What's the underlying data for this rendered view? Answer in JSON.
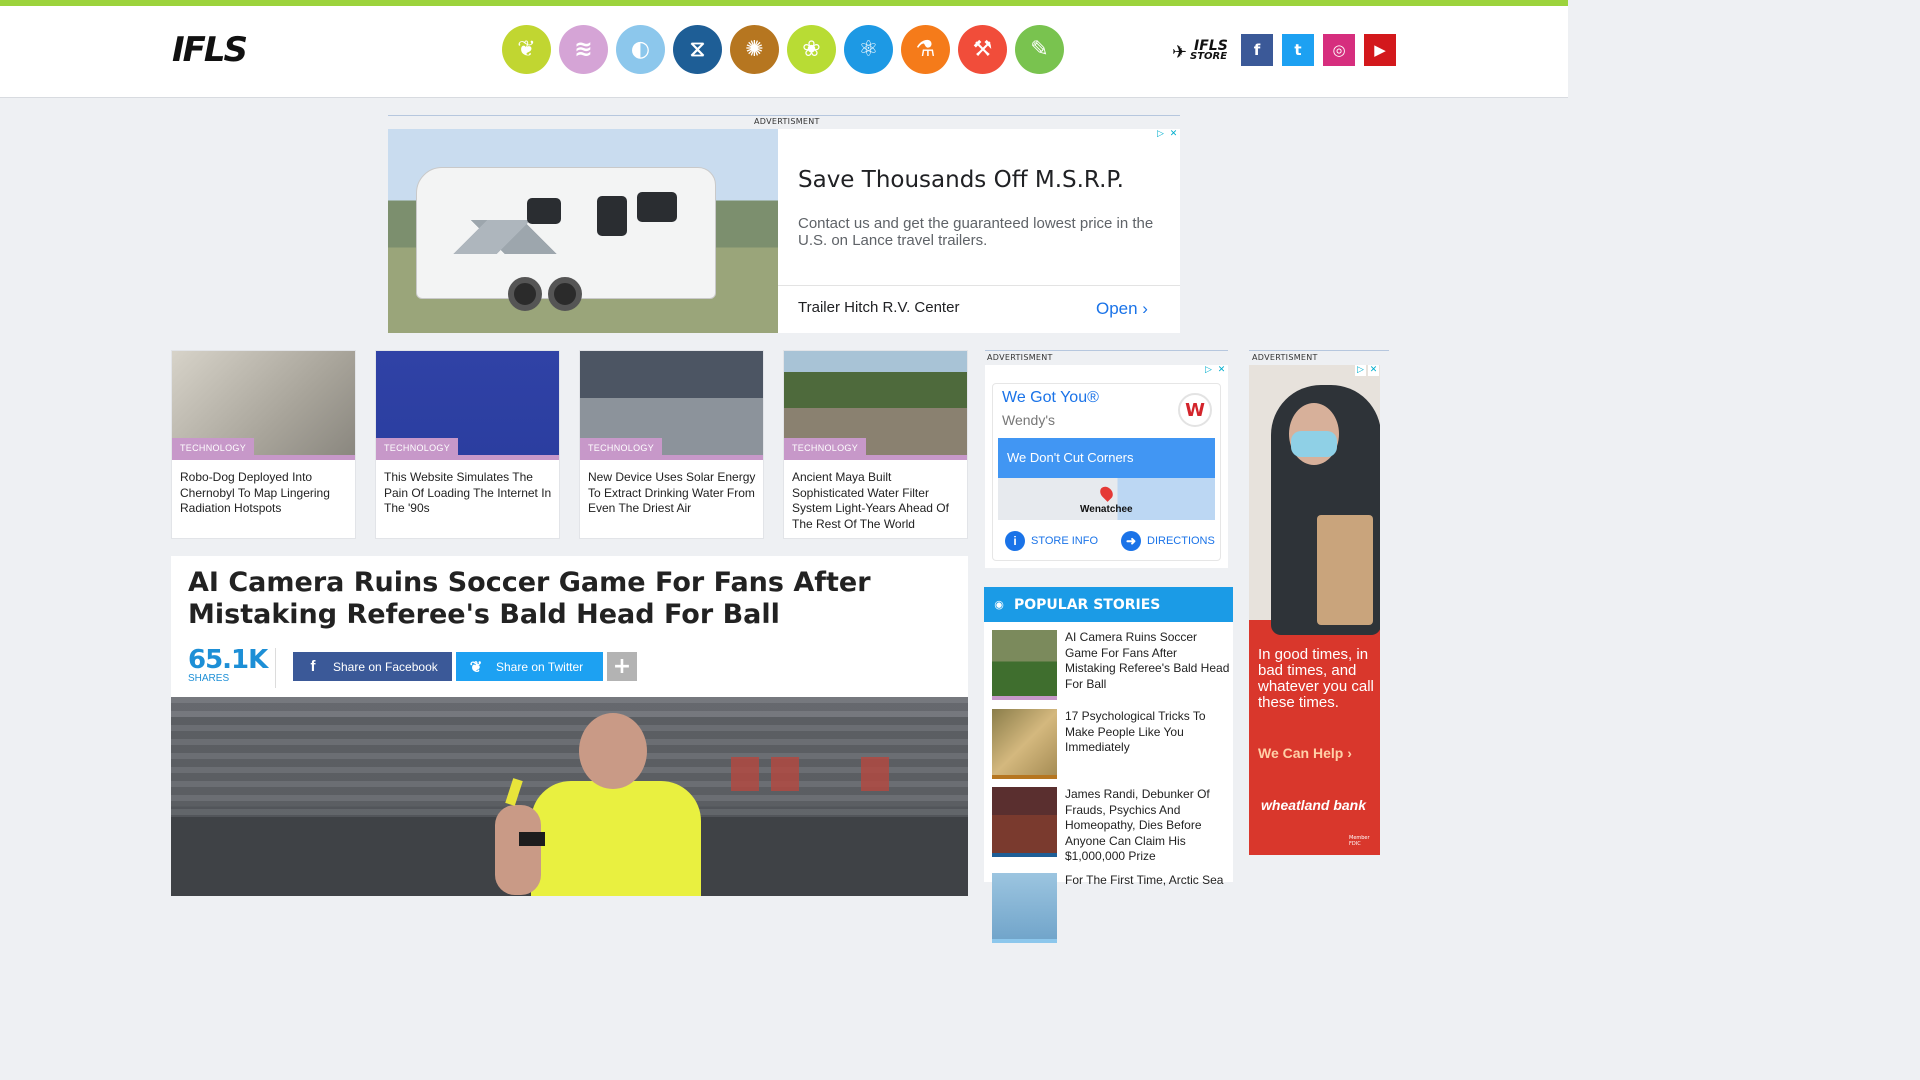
{
  "brand": {
    "logo_text": "IFLS",
    "store_text_1": "IFLS",
    "store_text_2": "STORE"
  },
  "categories": [
    {
      "name": "environment",
      "icon": "leaf-icon",
      "color": "#c1d631",
      "glyph": "❦"
    },
    {
      "name": "technology",
      "icon": "wifi-icon",
      "color": "#d5a4d6",
      "glyph": "≋"
    },
    {
      "name": "space",
      "icon": "planet-icon",
      "color": "#8cc7ec",
      "glyph": "◐"
    },
    {
      "name": "health",
      "icon": "dna-icon",
      "color": "#1e5e96",
      "glyph": "⧖"
    },
    {
      "name": "brain",
      "icon": "brain-icon",
      "color": "#b67620",
      "glyph": "✺"
    },
    {
      "name": "plants-animals",
      "icon": "paw-icon",
      "color": "#b8dc34",
      "glyph": "❀"
    },
    {
      "name": "physics",
      "icon": "atom-icon",
      "color": "#1d99e4",
      "glyph": "⚛"
    },
    {
      "name": "chemistry",
      "icon": "flask-icon",
      "color": "#f57b1a",
      "glyph": "⚗"
    },
    {
      "name": "editors-blog",
      "icon": "gavel-icon",
      "color": "#f14d3a",
      "glyph": "⚒"
    },
    {
      "name": "write",
      "icon": "pencil-icon",
      "color": "#79c34f",
      "glyph": "✎"
    }
  ],
  "social": [
    {
      "name": "facebook",
      "glyph": "f",
      "color": "#3b5998"
    },
    {
      "name": "twitter",
      "glyph": "t",
      "color": "#1da1f2"
    },
    {
      "name": "instagram",
      "glyph": "◎",
      "color": "#d62e7e"
    },
    {
      "name": "youtube",
      "glyph": "▶",
      "color": "#d3181c"
    }
  ],
  "ad_labels": {
    "top": "ADVERTISMENT",
    "side": "ADVERTISMENT",
    "right": "ADVERTISMENT"
  },
  "top_ad": {
    "headline": "Save Thousands Off M.S.R.P.",
    "body": "Contact us and get the guaranteed lowest price in the U.S. on Lance travel trailers.",
    "advertiser": "Trailer Hitch R.V. Center",
    "cta": "Open ›"
  },
  "related": [
    {
      "tag": "TECHNOLOGY",
      "title": "Robo-Dog Deployed Into Chernobyl To Map Lingering Radiation Hotspots",
      "bg": "linear-gradient(135deg,#d7d3c9 0%,#a9a59b 60%,#8a877f 100%)",
      "accent": "#f3b114"
    },
    {
      "tag": "TECHNOLOGY",
      "title": "This Website Simulates The Pain Of Loading The Internet In The '90s",
      "bg": "linear-gradient(#3042a6,#2b3ea0)",
      "accent": "#ffffff"
    },
    {
      "tag": "TECHNOLOGY",
      "title": "New Device Uses Solar Energy To Extract Drinking Water From Even The Driest Air",
      "bg": "linear-gradient(#4c5563 0 45%,#8c939b 45% 100%)",
      "accent": "#c8ced4"
    },
    {
      "tag": "TECHNOLOGY",
      "title": "Ancient Maya Built Sophisticated Water Filter System Light-Years Ahead Of The Rest Of The World",
      "bg": "linear-gradient(#a8c3d6 0 20%,#4e6a3c 20% 55%,#8a8170 55% 100%)",
      "accent": "#6b6455"
    }
  ],
  "article": {
    "title": "AI Camera Ruins Soccer Game For Fans After Mistaking Referee's Bald Head For Ball",
    "shares": "65.1K",
    "shares_label": "SHARES",
    "share_facebook": "Share on Facebook",
    "share_twitter": "Share on Twitter",
    "more": "+"
  },
  "side_ad": {
    "title": "We Got You®",
    "brand": "Wendy's",
    "tagline": "We Don't Cut Corners",
    "city": "Wenatchee",
    "store_info": "STORE INFO",
    "directions": "DIRECTIONS"
  },
  "popular": {
    "heading": "POPULAR STORIES",
    "items": [
      {
        "title": "AI Camera Ruins Soccer Game For Fans After Mistaking Referee's Bald Head For Ball",
        "bg": "linear-gradient(#7b8a5c 0 45%,#3f6e2e 45% 100%)",
        "underline": "#c798c9"
      },
      {
        "title": "17 Psychological Tricks To Make People Like You Immediately",
        "bg": "linear-gradient(135deg,#8a7d4a,#d4b87e 50%,#a38a52)",
        "underline": "#b67620"
      },
      {
        "title": "James Randi, Debunker Of Frauds, Psychics And Homeopathy, Dies Before Anyone Can Claim His $1,000,000 Prize",
        "bg": "linear-gradient(#5a2f2f 0 40%,#7a3a2e 40% 100%)",
        "underline": "#1e5e96"
      },
      {
        "title": "For The First Time, Arctic Sea",
        "bg": "linear-gradient(#9cc5e0,#6fa3c9)",
        "underline": "#8cc7ec"
      }
    ]
  },
  "right_ad": {
    "text": "In good times, in bad times, and whatever you call these times.",
    "cta": "We Can Help ›",
    "bank": "wheatland bank",
    "fine": "Member FDIC"
  }
}
